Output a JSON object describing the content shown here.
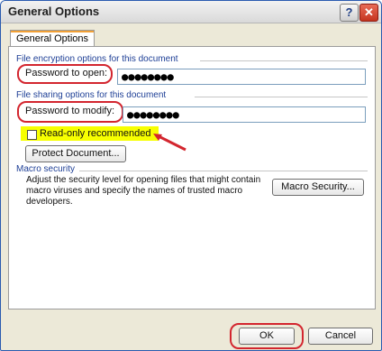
{
  "window": {
    "title": "General Options"
  },
  "tab": {
    "label": "General Options"
  },
  "sections": {
    "encryption": "File encryption options for this document",
    "sharing": "File sharing options for this document",
    "macro": "Macro security"
  },
  "password_open": {
    "label": "Password to open:",
    "value": "●●●●●●●●"
  },
  "password_modify": {
    "label": "Password to modify:",
    "value": "●●●●●●●●"
  },
  "read_only": {
    "label": "Read-only recommended"
  },
  "protect_document": {
    "label": "Protect Document..."
  },
  "macro": {
    "description": "Adjust the security level for opening files that might contain macro viruses and specify the names of trusted macro developers.",
    "button": "Macro Security..."
  },
  "buttons": {
    "ok": "OK",
    "cancel": "Cancel"
  }
}
